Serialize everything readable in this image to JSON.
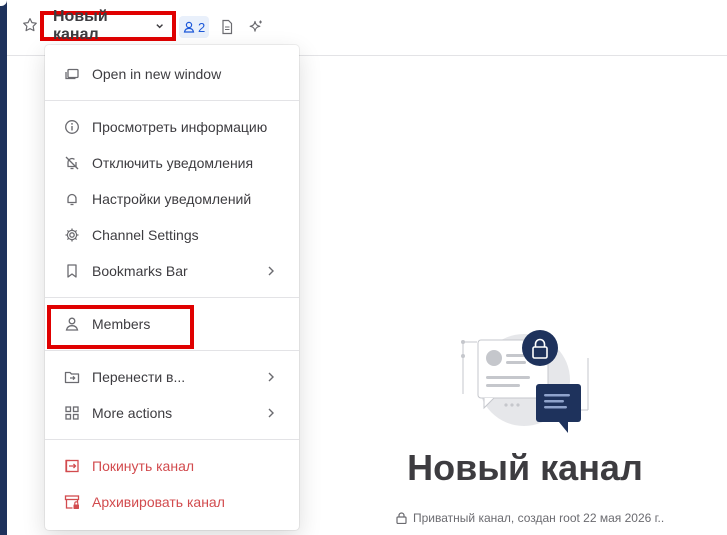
{
  "header": {
    "channel_title": "Новый канал",
    "member_count": "2"
  },
  "menu": {
    "open_new_window": "Open in new window",
    "view_info": "Просмотреть информацию",
    "mute": "Отключить уведомления",
    "notification_prefs": "Настройки уведомлений",
    "channel_settings": "Channel Settings",
    "bookmarks_bar": "Bookmarks Bar",
    "members": "Members",
    "move_to": "Перенести в...",
    "more_actions": "More actions",
    "leave": "Покинуть канал",
    "archive": "Архивировать канал"
  },
  "empty_state": {
    "title": "Новый канал",
    "subtitle": "Приватный канал, создан root 22 мая 2026 г.."
  },
  "colors": {
    "accent": "#1c58d9",
    "danger": "#d24b4e",
    "highlight": "#e00000",
    "sidebar": "#1e325c"
  }
}
